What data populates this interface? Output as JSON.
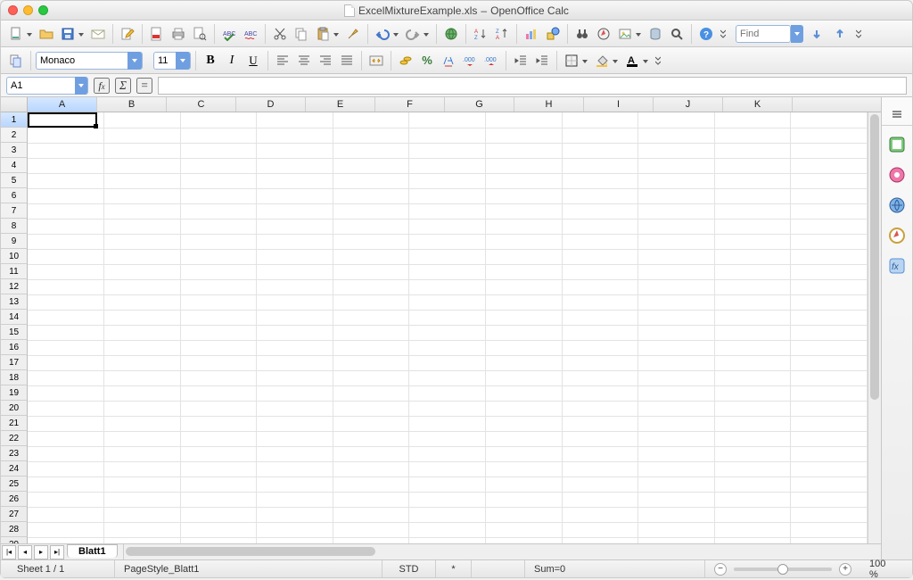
{
  "window": {
    "title_file": "ExcelMixtureExample.xls",
    "title_app": "OpenOffice Calc"
  },
  "toolbar1": {
    "find_placeholder": "Find"
  },
  "formatting": {
    "font_name": "Monaco",
    "font_size": "11",
    "bold": "B",
    "italic": "I",
    "underline": "U"
  },
  "formula_bar": {
    "cell_ref": "A1",
    "fx": "fx",
    "sigma": "Σ",
    "equals": "=",
    "formula": ""
  },
  "grid": {
    "columns": [
      "A",
      "B",
      "C",
      "D",
      "E",
      "F",
      "G",
      "H",
      "I",
      "J",
      "K"
    ],
    "row_count": 29,
    "selected_col": "A",
    "selected_row": 1
  },
  "tabs": {
    "sheet1": "Blatt1"
  },
  "status": {
    "sheet": "Sheet 1 / 1",
    "pagestyle": "PageStyle_Blatt1",
    "mode": "STD",
    "selmark": "*",
    "sum": "Sum=0",
    "zoom": "100 %"
  }
}
